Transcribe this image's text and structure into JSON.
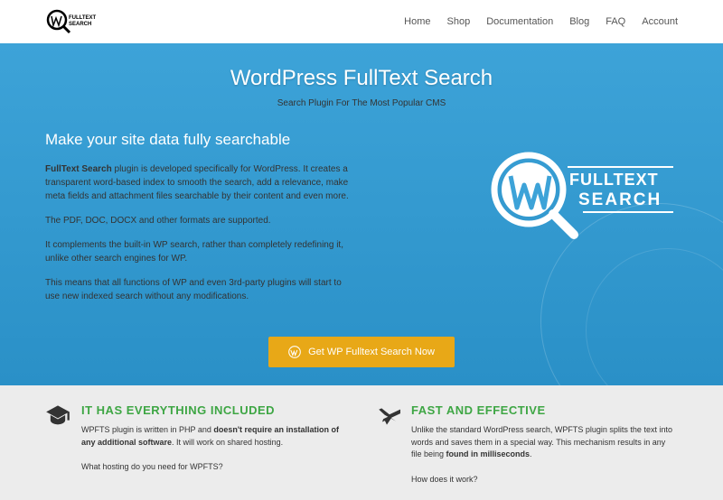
{
  "nav": {
    "items": [
      "Home",
      "Shop",
      "Documentation",
      "Blog",
      "FAQ",
      "Account"
    ]
  },
  "hero": {
    "title": "WordPress FullText Search",
    "subtitle": "Search Plugin For The Most Popular CMS",
    "heading": "Make your site data fully searchable",
    "para1_bold": "FullText Search",
    "para1_rest": " plugin is developed specifically for WordPress. It creates a transparent word-based index to smooth the search, add a relevance, make meta fields and attachment files searchable by their content and even more.",
    "para2": "The PDF, DOC, DOCX and other formats are supported.",
    "para3": "It complements the built-in WP search, rather than completely redefining it, unlike other search engines for WP.",
    "para4": "This means that all functions of WP and even 3rd-party plugins will start to use new indexed search without any modifications.",
    "cta_label": "Get WP Fulltext Search Now"
  },
  "features": [
    {
      "title": "IT HAS EVERYTHING INCLUDED",
      "text_pre": "WPFTS plugin is written in PHP and ",
      "text_bold": "doesn't require an installation of any additional software",
      "text_post": ". It will work on shared hosting.",
      "link": "What hosting do you need for WPFTS?"
    },
    {
      "title": "FAST AND EFFECTIVE",
      "text_pre": "Unlike the standard WordPress search, WPFTS plugin splits the text into words and saves them in a special way. This mechanism results in any file being ",
      "text_bold": "found in milliseconds",
      "text_post": ".",
      "link": "How does it work?"
    }
  ],
  "logo_text1": "FULLTEXT",
  "logo_text2": "SEARCH"
}
